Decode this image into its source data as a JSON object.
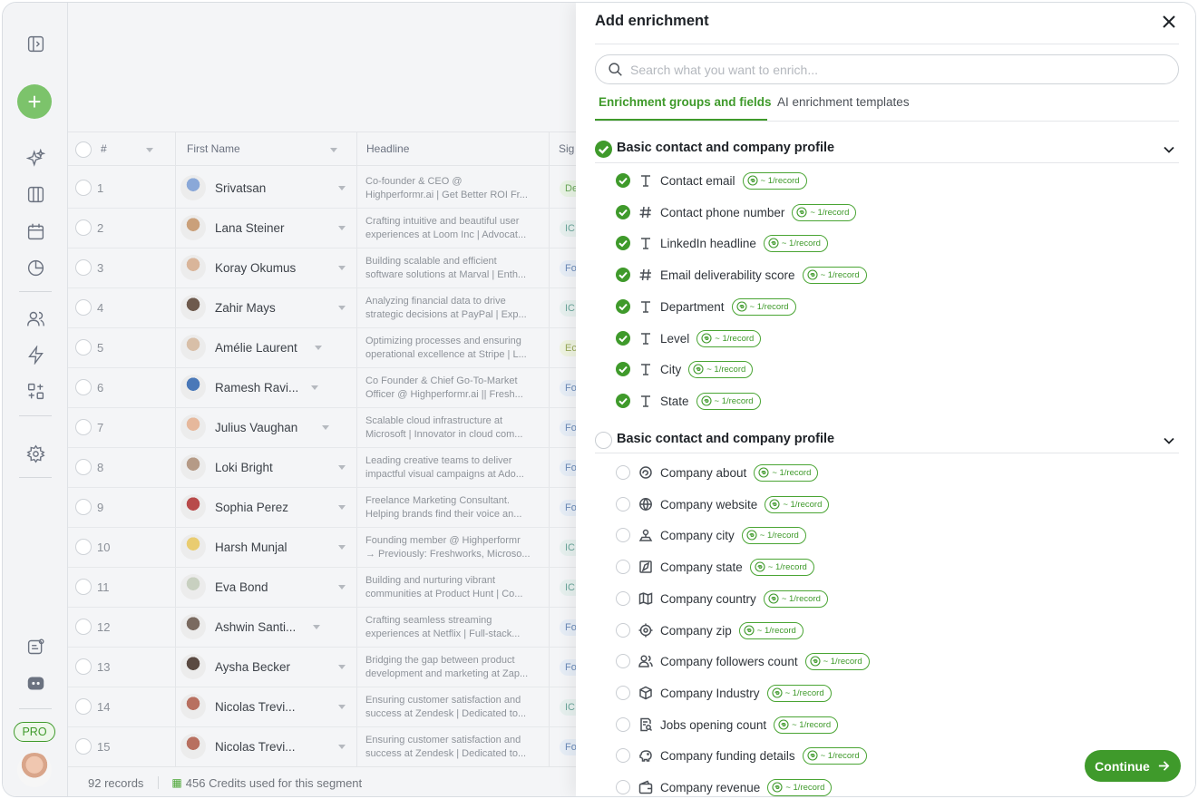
{
  "panel": {
    "title": "Add enrichment",
    "search_placeholder": "Search what you want to enrich...",
    "tabs": [
      {
        "label": "Enrichment groups and fields",
        "active": true
      },
      {
        "label": "AI enrichment templates",
        "active": false
      }
    ],
    "cost_label": "~ 1/record",
    "groups": [
      {
        "title": "Basic contact and company profile",
        "checked": true,
        "fields": [
          {
            "label": "Contact email",
            "icon": "text-icon",
            "checked": true
          },
          {
            "label": "Contact phone number",
            "icon": "hash-icon",
            "checked": true
          },
          {
            "label": "LinkedIn headline",
            "icon": "text-icon",
            "checked": true
          },
          {
            "label": "Email deliverability score",
            "icon": "hash-icon",
            "checked": true
          },
          {
            "label": "Department",
            "icon": "text-icon",
            "checked": true
          },
          {
            "label": "Level",
            "icon": "text-icon",
            "checked": true
          },
          {
            "label": "City",
            "icon": "text-icon",
            "checked": true
          },
          {
            "label": "State",
            "icon": "text-icon",
            "checked": true
          }
        ]
      },
      {
        "title": "Basic contact and company profile",
        "checked": false,
        "fields": [
          {
            "label": "Company about",
            "icon": "about-icon",
            "checked": false
          },
          {
            "label": "Company website",
            "icon": "globe-icon",
            "checked": false
          },
          {
            "label": "Company city",
            "icon": "location-pin-icon",
            "checked": false
          },
          {
            "label": "Company state",
            "icon": "state-map-icon",
            "checked": false
          },
          {
            "label": "Company country",
            "icon": "map-icon",
            "checked": false
          },
          {
            "label": "Company zip",
            "icon": "target-icon",
            "checked": false
          },
          {
            "label": "Company followers count",
            "icon": "users-icon",
            "checked": false
          },
          {
            "label": "Company Industry",
            "icon": "cube-icon",
            "checked": false
          },
          {
            "label": "Jobs opening count",
            "icon": "document-search-icon",
            "checked": false
          },
          {
            "label": "Company funding details",
            "icon": "piggy-bank-icon",
            "checked": false
          },
          {
            "label": "Company revenue",
            "icon": "wallet-icon",
            "checked": false
          }
        ]
      }
    ],
    "continue_label": "Continue"
  },
  "table": {
    "columns": {
      "num": "#",
      "first_name": "First Name",
      "headline": "Headline",
      "signal": "Sig"
    },
    "rows": [
      {
        "num": "1",
        "name": "Srivatsan",
        "h1": "Co-founder & CEO @",
        "h2": "Highperformr.ai | Get Better ROI Fr...",
        "sig": "De"
      },
      {
        "num": "2",
        "name": "Lana Steiner",
        "h1": "Crafting intuitive and beautiful user",
        "h2": "experiences at Loom Inc | Advocat...",
        "sig": "IC"
      },
      {
        "num": "3",
        "name": "Koray Okumus",
        "h1": "Building scalable and efficient",
        "h2": "software solutions at Marval | Enth...",
        "sig": "Fo"
      },
      {
        "num": "4",
        "name": "Zahir Mays",
        "h1": "Analyzing financial data to drive",
        "h2": "strategic decisions at PayPal | Exp...",
        "sig": "IC"
      },
      {
        "num": "5",
        "name": "Amélie Laurent",
        "h1": "Optimizing processes and ensuring",
        "h2": "operational excellence at Stripe | L...",
        "sig": "Ec"
      },
      {
        "num": "6",
        "name": "Ramesh Ravi...",
        "h1": "Co Founder & Chief Go-To-Market",
        "h2": "Officer @ Highperformr.ai || Fresh...",
        "sig": "Fo"
      },
      {
        "num": "7",
        "name": "Julius Vaughan",
        "h1": "Scalable cloud infrastructure at",
        "h2": "Microsoft | Innovator in cloud com...",
        "sig": "Fo"
      },
      {
        "num": "8",
        "name": "Loki Bright",
        "h1": "Leading creative teams to deliver",
        "h2": "impactful visual campaigns at Ado...",
        "sig": "Fo"
      },
      {
        "num": "9",
        "name": "Sophia Perez",
        "h1": "Freelance Marketing Consultant.",
        "h2": "Helping brands find their voice an...",
        "sig": "Fo"
      },
      {
        "num": "10",
        "name": "Harsh Munjal",
        "h1": "Founding member @ Highperformr",
        "h2": "→ Previously: Freshworks, Microso...",
        "sig": "IC"
      },
      {
        "num": "11",
        "name": "Eva Bond",
        "h1": "Building and nurturing vibrant",
        "h2": "communities at Product Hunt | Co...",
        "sig": "IC"
      },
      {
        "num": "12",
        "name": "Ashwin Santi...",
        "h1": "Crafting seamless streaming",
        "h2": "experiences at Netflix | Full-stack...",
        "sig": "Fo"
      },
      {
        "num": "13",
        "name": "Aysha Becker",
        "h1": "Bridging the gap between product",
        "h2": "development and marketing at Zap...",
        "sig": "Fo"
      },
      {
        "num": "14",
        "name": "Nicolas Trevi...",
        "h1": "Ensuring customer satisfaction and",
        "h2": "success at Zendesk | Dedicated to...",
        "sig": "IC"
      },
      {
        "num": "15",
        "name": "Nicolas Trevi...",
        "h1": "Ensuring customer satisfaction and",
        "h2": "success at Zendesk | Dedicated to...",
        "sig": "Fo"
      }
    ],
    "footer": {
      "records": "92 records",
      "credits": "456 Credits used for this segment"
    }
  },
  "sidebar": {
    "pro_label": "PRO"
  },
  "colors": {
    "accent": "#3f9a2b",
    "add_button": "#7cc36b"
  }
}
